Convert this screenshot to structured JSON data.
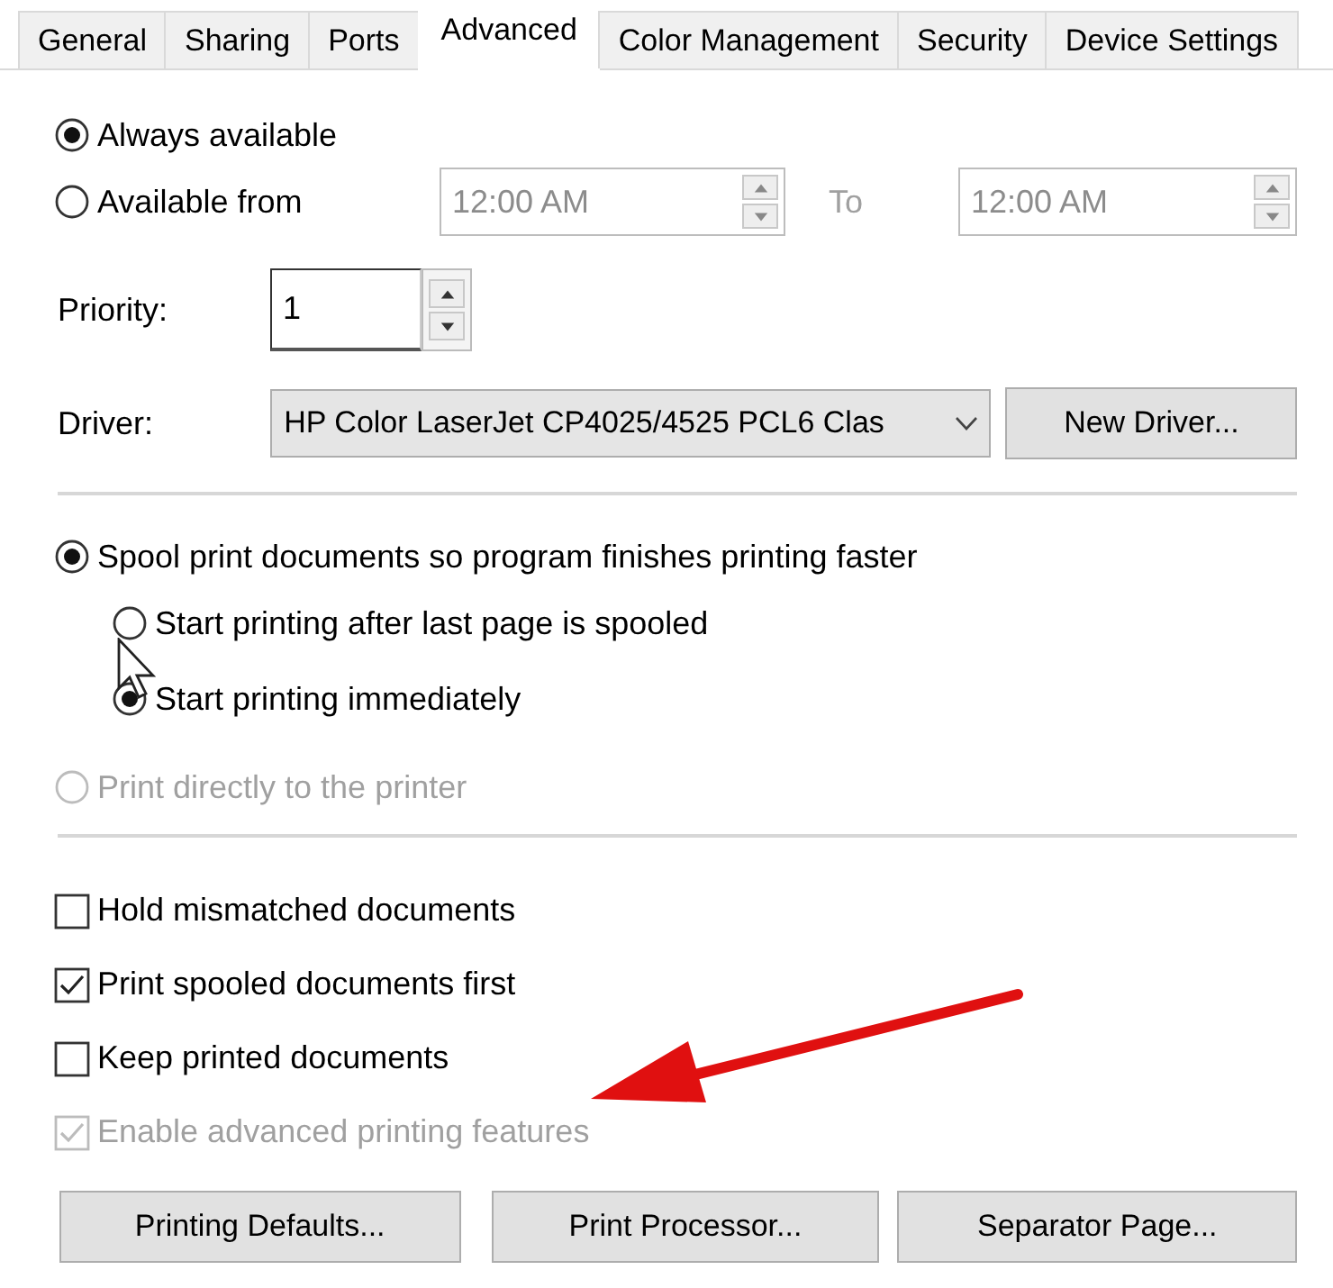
{
  "tabs": [
    {
      "label": "General",
      "selected": false
    },
    {
      "label": "Sharing",
      "selected": false
    },
    {
      "label": "Ports",
      "selected": false
    },
    {
      "label": "Advanced",
      "selected": true
    },
    {
      "label": "Color Management",
      "selected": false
    },
    {
      "label": "Security",
      "selected": false
    },
    {
      "label": "Device Settings",
      "selected": false
    }
  ],
  "availability": {
    "options": [
      {
        "label": "Always available",
        "selected": true
      },
      {
        "label": "Available from",
        "selected": false
      }
    ],
    "time_from": {
      "value": "12:00 AM",
      "disabled": true
    },
    "to_label": "To",
    "time_to": {
      "value": "12:00 AM",
      "disabled": true
    }
  },
  "priority": {
    "label": "Priority:",
    "value": "1"
  },
  "driver": {
    "label": "Driver:",
    "value": "HP Color LaserJet CP4025/4525 PCL6 Clas",
    "button": "New Driver..."
  },
  "spooling": [
    {
      "label": "Spool print documents so program finishes printing faster",
      "selected": true,
      "disabled": false,
      "children": [
        {
          "label": "Start printing after last page is spooled",
          "selected": false,
          "disabled": false
        },
        {
          "label": "Start printing immediately",
          "selected": true,
          "disabled": false
        }
      ]
    },
    {
      "label": "Print directly to the printer",
      "selected": false,
      "disabled": true
    }
  ],
  "checkboxes": [
    {
      "label": "Hold mismatched documents",
      "checked": false,
      "disabled": false
    },
    {
      "label": "Print spooled documents first",
      "checked": true,
      "disabled": false
    },
    {
      "label": "Keep printed documents",
      "checked": false,
      "disabled": false
    },
    {
      "label": "Enable advanced printing features",
      "checked": true,
      "disabled": true
    }
  ],
  "buttons": [
    "Printing Defaults...",
    "Print Processor...",
    "Separator Page..."
  ]
}
